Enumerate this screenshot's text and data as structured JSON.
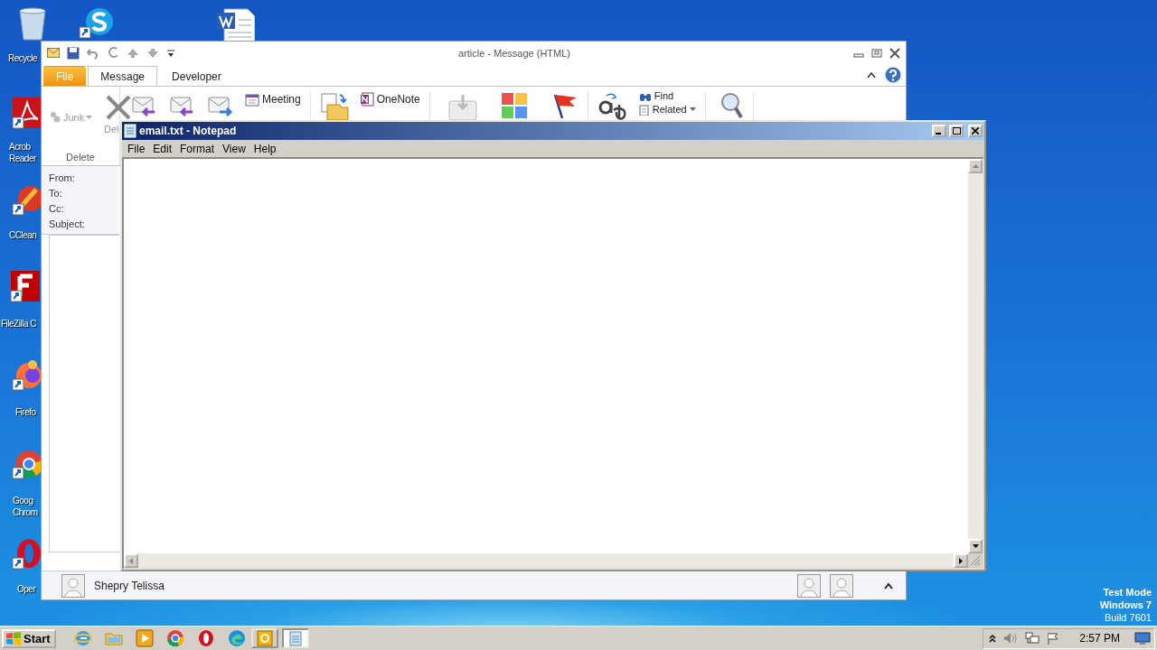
{
  "desktop": {
    "icons": [
      {
        "kind": "recycle-bin",
        "label": "Recycle"
      },
      {
        "kind": "skype"
      },
      {
        "kind": "word-doc"
      },
      {
        "kind": "acrobat",
        "label": "Acrob\nReader"
      },
      {
        "kind": "ccleaner",
        "label": "CClean"
      },
      {
        "kind": "filezilla",
        "label": "FileZilla C"
      },
      {
        "kind": "firefox",
        "label": "Firefo"
      },
      {
        "kind": "chrome",
        "label": "Goog\nChrom"
      },
      {
        "kind": "opera",
        "label": "Oper"
      }
    ],
    "os_notice": [
      "Test Mode",
      "Windows 7",
      "Build 7601"
    ]
  },
  "outlook": {
    "title": "article - Message (HTML)",
    "tabs": [
      {
        "label": "File",
        "kind": "file",
        "selected": false
      },
      {
        "label": "Message",
        "kind": "tab",
        "selected": true
      },
      {
        "label": "Developer",
        "kind": "tab",
        "selected": false
      }
    ],
    "ribbon": {
      "junk": "Junk",
      "delete_cut": "Del",
      "group_label": "Delete",
      "meeting": "Meeting",
      "onenote": "OneNote",
      "find": "Find",
      "related": "Related"
    },
    "header_fields": [
      "From:",
      "To:",
      "Cc:",
      "Subject:"
    ],
    "people_pane": {
      "name": "Shepry Telissa"
    }
  },
  "notepad": {
    "title": "email.txt - Notepad",
    "menu": [
      "File",
      "Edit",
      "Format",
      "View",
      "Help"
    ]
  },
  "taskbar": {
    "start": "Start",
    "quick_launch": [
      {
        "kind": "ie"
      },
      {
        "kind": "explorer"
      },
      {
        "kind": "media"
      },
      {
        "kind": "chrome"
      },
      {
        "kind": "opera"
      },
      {
        "kind": "edge"
      }
    ],
    "windows": [
      {
        "kind": "outlook",
        "selected": false
      },
      {
        "kind": "notepad",
        "selected": true
      }
    ],
    "clock": "2:57 PM"
  }
}
